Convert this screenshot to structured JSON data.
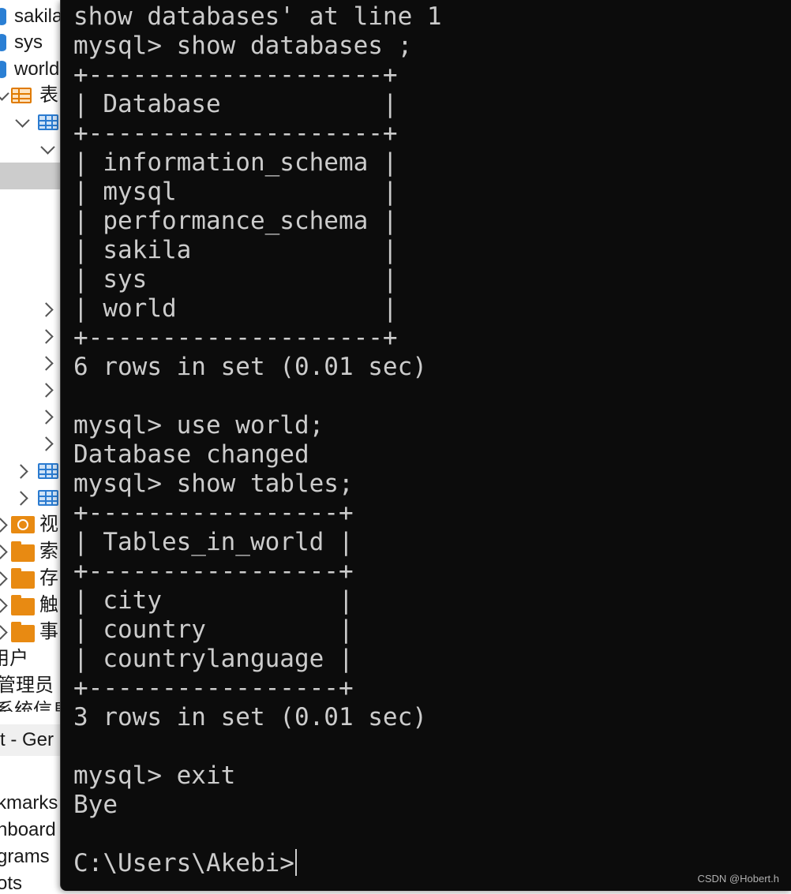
{
  "navigator": {
    "items": [
      {
        "label": "sakila",
        "icon": "database-icon"
      },
      {
        "label": "sys",
        "icon": "database-icon"
      },
      {
        "label": "world",
        "icon": "database-icon"
      },
      {
        "label": "表",
        "icon": "table-group-icon"
      },
      {
        "label": "视",
        "icon": "view-icon"
      },
      {
        "label": "索",
        "icon": "folder-icon"
      },
      {
        "label": "存",
        "icon": "folder-icon"
      },
      {
        "label": "触",
        "icon": "folder-icon"
      },
      {
        "label": "事",
        "icon": "folder-icon"
      },
      {
        "label": "用户"
      },
      {
        "label": "管理员"
      },
      {
        "label": "系统信息"
      },
      {
        "label": "t - Ger"
      },
      {
        "label": "kmarks"
      },
      {
        "label": "hboard"
      },
      {
        "label": "grams"
      },
      {
        "label": "ots"
      }
    ]
  },
  "terminal": {
    "lines": [
      "show databases' at line 1",
      "mysql> show databases ;",
      "+--------------------+",
      "| Database           |",
      "+--------------------+",
      "| information_schema |",
      "| mysql              |",
      "| performance_schema |",
      "| sakila             |",
      "| sys                |",
      "| world              |",
      "+--------------------+",
      "6 rows in set (0.01 sec)",
      "",
      "mysql> use world;",
      "Database changed",
      "mysql> show tables;",
      "+-----------------+",
      "| Tables_in_world |",
      "+-----------------+",
      "| city            |",
      "| country         |",
      "| countrylanguage |",
      "+-----------------+",
      "3 rows in set (0.01 sec)",
      "",
      "mysql> exit",
      "Bye",
      "",
      "C:\\Users\\Akebi>"
    ]
  },
  "watermark": "CSDN @Hobert.h",
  "colors": {
    "terminal_bg": "#0c0c0c",
    "terminal_fg": "#cccccc",
    "accent_blue": "#2b7bd0",
    "accent_orange": "#e88a12"
  }
}
